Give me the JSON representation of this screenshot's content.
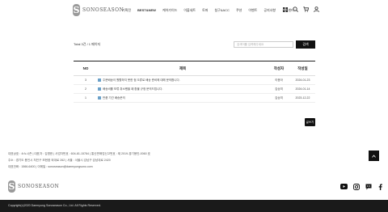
{
  "header": {
    "logo_mark": "S",
    "logo_text": "SONOSEASON",
    "nav": [
      "기획전",
      "BEST&NEW",
      "케어가이드",
      "이불세트",
      "토퍼",
      "침구&ACC",
      "쿠션",
      "이벤트",
      "공지사항",
      "고객센터"
    ],
    "icons": [
      "menu-icon",
      "search-icon",
      "cart-icon",
      "user-icon"
    ]
  },
  "summary": {
    "total": "Total 3건 / 1 페이지",
    "search_placeholder": "검색어를 입력해주세요",
    "search_label": "검색"
  },
  "table": {
    "headers": {
      "no": "NO",
      "title": "제목",
      "author": "작성자",
      "date": "작성일"
    },
    "rows": [
      {
        "no": "3",
        "title": "주문배송이 원활하지 못한 점 오류로 배송 준비에 대해 문의합니다.",
        "author": "이종아",
        "date": "2024-01-23"
      },
      {
        "no": "2",
        "title": "배송비를 보류 취소했을 때 환불 규정 문의드립니다.",
        "author": "김승미",
        "date": "2024-01-14"
      },
      {
        "no": "1",
        "title": "반품 기간 배송문의",
        "author": "김승미",
        "date": "2023-12-22"
      }
    ]
  },
  "write_label": "글쓰기",
  "footer": {
    "lines": [
      "대표상호 : 소노시즌  |  대표자 : 김명한  |  사업자번호 : 604-81-15784  |  통신판매업신고번호 : 제 2019-경기용인-0060 호",
      "주소 : 경기도 용인시 처인구 모현읍 외대로 262  |  서울 : 서울시 강남구 강남대로 2420",
      "대표전화 : 1566-6400  |  이메일 : sonoseason@daemyungsono.com"
    ],
    "logo_text": "SONOSEASON",
    "socials": [
      "youtube-icon",
      "instagram-icon",
      "chat-icon",
      "facebook-icon"
    ],
    "copyright": "Copyright(c)2020 Daemyung Sonoseason Co., Ltd. All Rights Reserved."
  }
}
